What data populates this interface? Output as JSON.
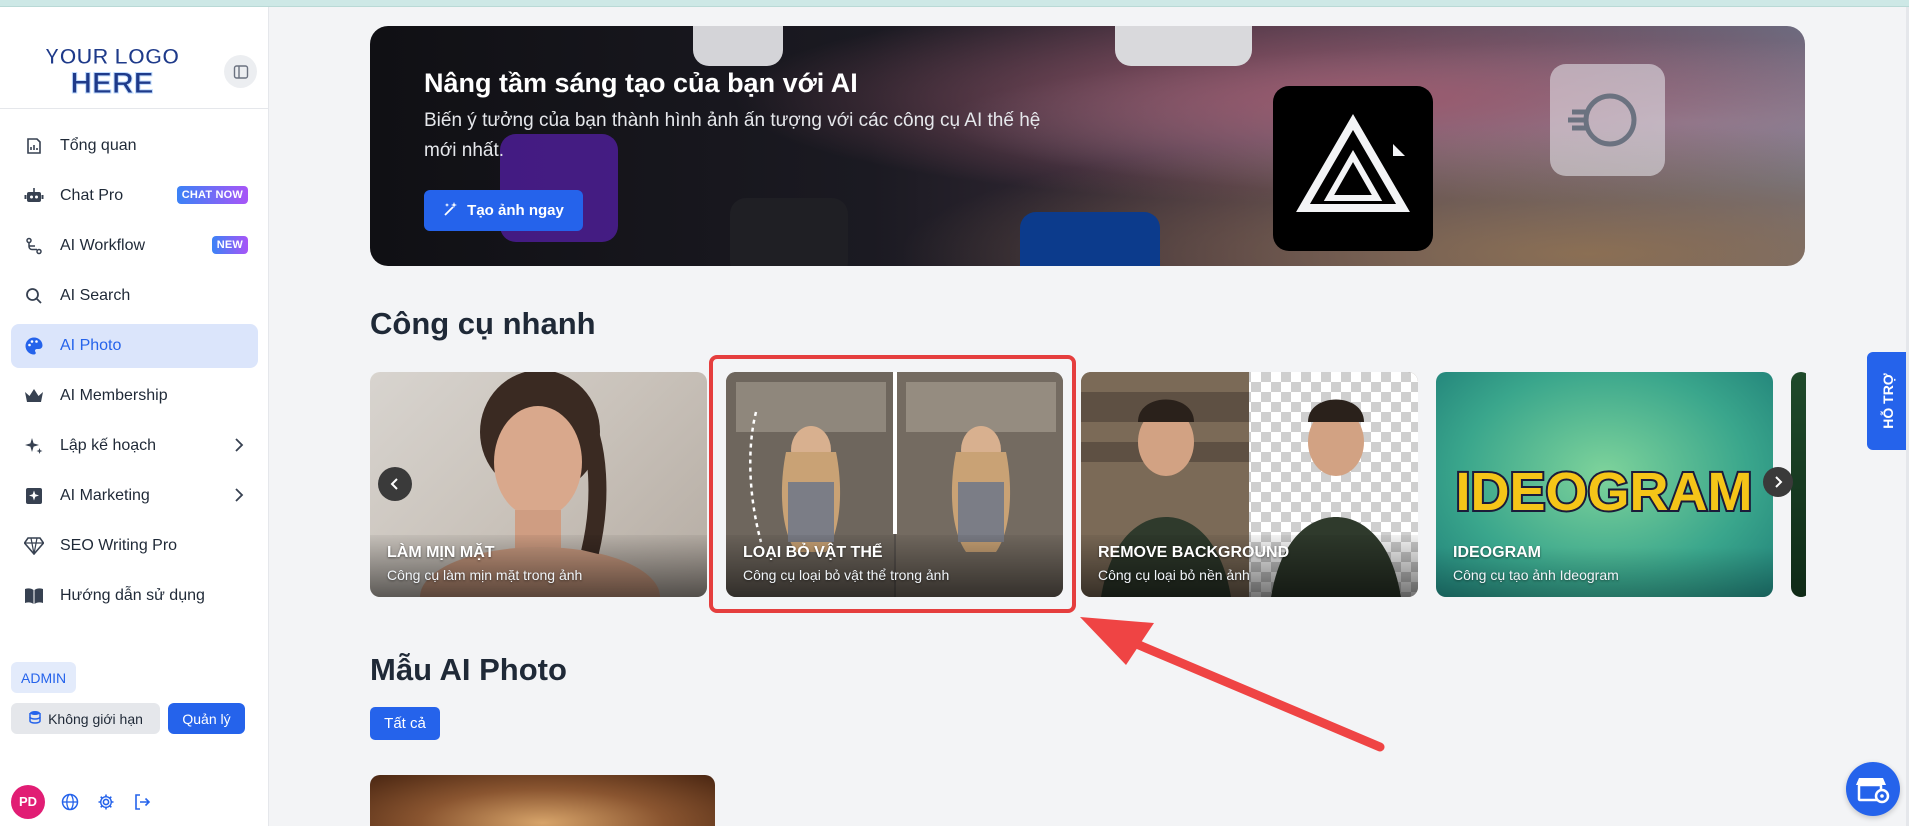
{
  "sidebar": {
    "logo_text_1": "YOUR LOGO",
    "logo_text_2": "HERE",
    "items": [
      {
        "label": "Tổng quan",
        "icon": "chart-icon"
      },
      {
        "label": "Chat Pro",
        "icon": "robot-icon",
        "badge": "CHAT NOW"
      },
      {
        "label": "AI Workflow",
        "icon": "workflow-icon",
        "badge": "NEW"
      },
      {
        "label": "AI Search",
        "icon": "search-icon"
      },
      {
        "label": "AI Photo",
        "icon": "palette-icon",
        "active": true
      },
      {
        "label": "AI Membership",
        "icon": "crown-icon"
      },
      {
        "label": "Lập kế hoạch",
        "icon": "sparkle-icon"
      },
      {
        "label": "AI Marketing",
        "icon": "marketing-icon"
      },
      {
        "label": "SEO Writing Pro",
        "icon": "diamond-icon"
      },
      {
        "label": "Hướng dẫn sử dụng",
        "icon": "book-icon"
      }
    ],
    "role": "ADMIN",
    "limit_label": "Không giới hạn",
    "manage_label": "Quản lý",
    "avatar_initials": "PD"
  },
  "hero": {
    "title": "Nâng tầm sáng tạo của bạn với AI",
    "subtitle": "Biến ý tưởng của bạn thành hình ảnh ấn tượng với các công cụ AI thế hệ mới nhất.",
    "button_label": "Tạo ảnh ngay"
  },
  "quick_tools": {
    "title": "Công cụ nhanh",
    "cards": [
      {
        "name": "LÀM MỊN MẶT",
        "desc": "Công cụ làm mịn mặt trong ảnh"
      },
      {
        "name": "LOẠI BỎ VẬT THỂ",
        "desc": "Công cụ loại bỏ vật thể trong ảnh"
      },
      {
        "name": "REMOVE BACKGROUND",
        "desc": "Công cụ loại bỏ nền ảnh"
      },
      {
        "name": "IDEOGRAM",
        "desc": "Công cụ tạo ảnh Ideogram",
        "art_text": "IDEOGRAM"
      }
    ]
  },
  "samples": {
    "title": "Mẫu AI Photo",
    "filter_label": "Tất cả"
  },
  "support_label": "HỖ TRỢ",
  "colors": {
    "accent": "#2563eb",
    "highlight": "#e53e3e",
    "active_bg": "#dbe5fb"
  }
}
